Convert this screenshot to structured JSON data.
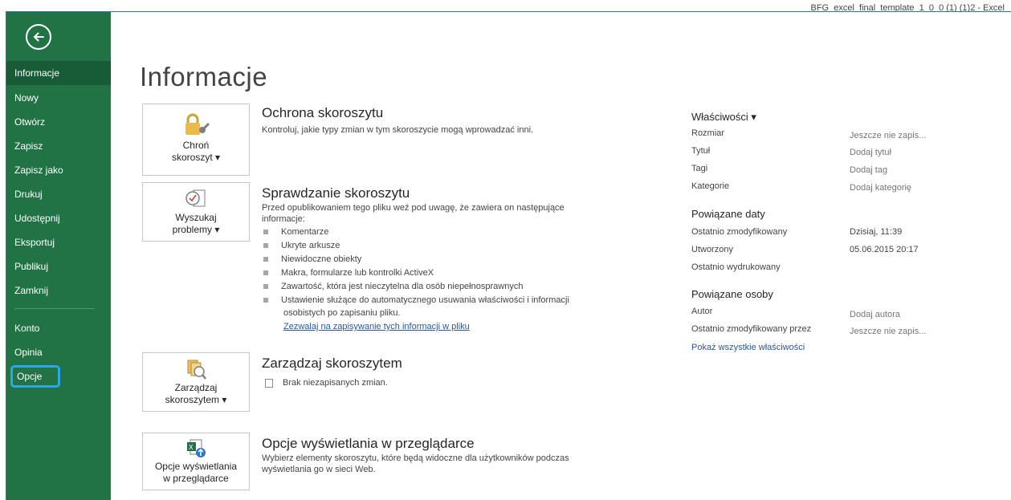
{
  "titlebar": {
    "title": "BFG_excel_final_template_1_0_0 (1) (1)2  -  Excel"
  },
  "sidebar": {
    "items": [
      {
        "label": "Informacje"
      },
      {
        "label": "Nowy"
      },
      {
        "label": "Otwórz"
      },
      {
        "label": "Zapisz"
      },
      {
        "label": "Zapisz jako"
      },
      {
        "label": "Drukuj"
      },
      {
        "label": "Udostępnij"
      },
      {
        "label": "Eksportuj"
      },
      {
        "label": "Publikuj"
      },
      {
        "label": "Zamknij"
      },
      {
        "label": "Konto"
      },
      {
        "label": "Opinia"
      },
      {
        "label": "Opcje"
      }
    ]
  },
  "page": {
    "title": "Informacje"
  },
  "protect": {
    "button": "Chroń\nskoroszyt ▾",
    "title": "Ochrona skoroszytu",
    "desc": "Kontroluj, jakie typy zmian w tym skoroszycie mogą wprowadzać inni."
  },
  "inspect": {
    "button": "Wyszukaj\nproblemy ▾",
    "title": "Sprawdzanie skoroszytu",
    "desc_line1": "Przed opublikowaniem tego pliku weź pod uwagę, że zawiera on następujące",
    "desc_line2": "informacje:",
    "bullets": [
      "Komentarze",
      "Ukryte arkusze",
      "Niewidoczne obiekty",
      "Makra, formularze lub kontrolki ActiveX",
      "Zawartość, która jest nieczytelna dla osób niepełnosprawnych",
      "Ustawienie służące do automatycznego usuwania właściwości i informacji"
    ],
    "bullet_cont": "osobistych po zapisaniu pliku.",
    "link": "Zezwalaj na zapisywanie tych informacji w pliku"
  },
  "manage": {
    "button": "Zarządzaj\nskoroszytem ▾",
    "title": "Zarządzaj skoroszytem",
    "desc": "Brak niezapisanych zmian."
  },
  "browser": {
    "button": "Opcje wyświetlania\nw przeglądarce",
    "title": "Opcje wyświetlania w przeglądarce",
    "desc_line1": "Wybierz elementy skoroszytu, które będą widoczne dla użytkowników podczas",
    "desc_line2": "wyświetlania go w sieci Web."
  },
  "properties": {
    "heading": "Właściwości ▾",
    "rows": [
      {
        "label": "Rozmiar",
        "value": "Jeszcze nie zapis..."
      },
      {
        "label": "Tytuł",
        "value": "Dodaj tytuł"
      },
      {
        "label": "Tagi",
        "value": "Dodaj tag"
      },
      {
        "label": "Kategorie",
        "value": "Dodaj kategorię"
      }
    ],
    "dates_heading": "Powiązane daty",
    "dates": [
      {
        "label": "Ostatnio zmodyfikowany",
        "value": "Dzisiaj, 11:39"
      },
      {
        "label": "Utworzony",
        "value": "05.06.2015 20:17"
      },
      {
        "label": "Ostatnio wydrukowany",
        "value": ""
      }
    ],
    "people_heading": "Powiązane osoby",
    "people": [
      {
        "label": "Autor",
        "value": "Dodaj autora"
      },
      {
        "label": "Ostatnio zmodyfikowany przez",
        "value": "Jeszcze nie zapis..."
      }
    ],
    "show_all": "Pokaż wszystkie właściwości"
  },
  "colors": {
    "sidebar": "#217346",
    "sidebar_active": "#185c37",
    "highlight": "#2ea7e8",
    "link": "#2b5797"
  }
}
